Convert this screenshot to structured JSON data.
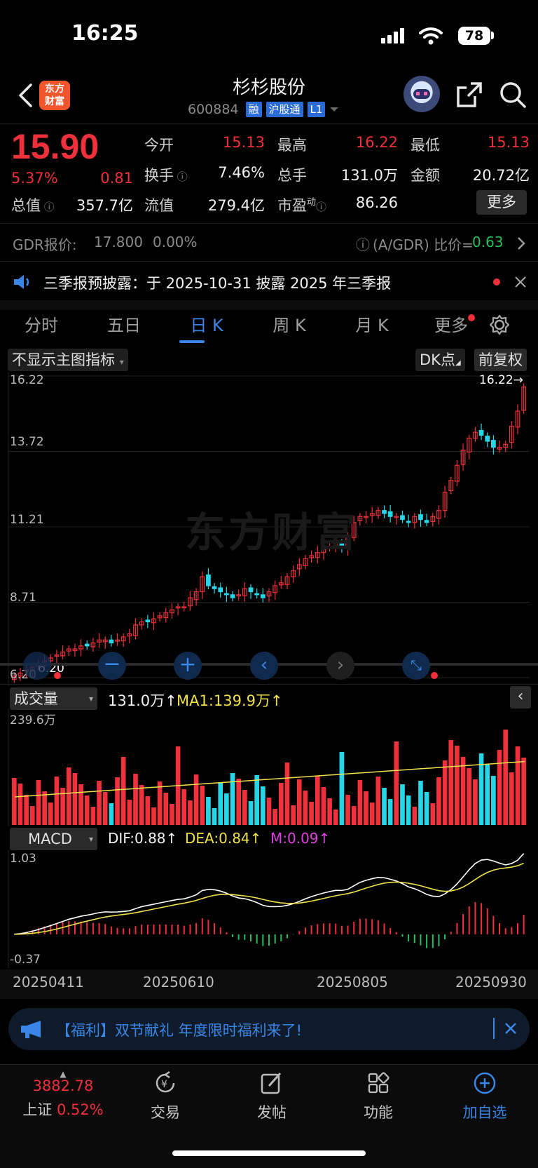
{
  "status_bar": {
    "time": "16:25",
    "battery": "78"
  },
  "header": {
    "logo_line1": "东方",
    "logo_line2": "财富",
    "stock_name": "杉杉股份",
    "stock_code": "600884",
    "tags": [
      "融",
      "沪股通",
      "L1"
    ]
  },
  "quote": {
    "price": "15.90",
    "change_pct": "5.37%",
    "change_abs": "0.81",
    "labels": {
      "open": "今开",
      "high": "最高",
      "low": "最低",
      "turnover": "换手",
      "volume": "总手",
      "amount": "金额",
      "mktcap": "总值",
      "float_cap": "流值",
      "pe": "市盈",
      "pe_sup": "动"
    },
    "values": {
      "open": "15.13",
      "high": "16.22",
      "low": "15.13",
      "turnover": "7.46%",
      "volume": "131.0万",
      "amount": "20.72亿",
      "mktcap": "357.7亿",
      "float_cap": "279.4亿",
      "pe": "86.26"
    },
    "more_button": "更多"
  },
  "gdr": {
    "label": "GDR报价:",
    "price": "17.800",
    "change": "0.00%",
    "ratio_label": "(A/GDR) 比价=",
    "ratio": "0.63"
  },
  "notice": {
    "text": "三季报预披露：于 2025-10-31 披露 2025 年三季报"
  },
  "tabs": [
    "分时",
    "五日",
    "日 K",
    "周 K",
    "月 K",
    "更多"
  ],
  "kline": {
    "indicator_select": "不显示主图指标",
    "dk_button": "DK点",
    "adjust_button": "前复权",
    "y_labels": [
      "16.22",
      "13.72",
      "11.21",
      "8.71",
      "6.20"
    ],
    "max_marker": "16.22→",
    "min_marker": "6.20",
    "watermark": "东方财富"
  },
  "volume": {
    "select": "成交量",
    "value": "131.0万",
    "ma_label": "MA1:139.9万",
    "ymax": "239.6万"
  },
  "macd": {
    "select": "MACD",
    "dif": "DIF:0.88",
    "dea": "DEA:0.84",
    "m": "M:0.09",
    "ymax": "1.03",
    "ymin": "-0.37"
  },
  "x_dates": [
    "20250411",
    "20250610",
    "20250805",
    "20250930"
  ],
  "promo": {
    "text": "【福利】双节献礼 年度限时福利来了!"
  },
  "bottom_nav": {
    "index_value": "3882.78",
    "index_name": "上证",
    "index_change": "0.52%",
    "items": [
      "交易",
      "发帖",
      "功能",
      "加自选"
    ]
  },
  "chart_data": {
    "type": "candlestick",
    "price_axis": [
      6.2,
      16.22
    ],
    "closes": [
      6.3,
      6.4,
      6.5,
      6.6,
      6.7,
      6.8,
      6.9,
      7.0,
      7.1,
      7.2,
      7.2,
      7.3,
      7.3,
      7.4,
      7.5,
      7.5,
      7.4,
      7.5,
      7.6,
      7.7,
      8.0,
      8.1,
      8.1,
      8.2,
      8.3,
      8.4,
      8.5,
      8.6,
      8.6,
      8.9,
      9.1,
      9.6,
      9.3,
      9.2,
      9.1,
      9.0,
      8.9,
      9.0,
      9.2,
      9.1,
      9.0,
      8.9,
      9.1,
      9.3,
      9.4,
      9.6,
      9.8,
      10.0,
      10.2,
      10.3,
      10.4,
      10.5,
      10.6,
      10.7,
      10.6,
      10.9,
      11.4,
      11.6,
      11.6,
      11.7,
      11.8,
      11.7,
      11.6,
      11.6,
      11.5,
      11.4,
      11.6,
      11.5,
      11.4,
      11.6,
      11.8,
      12.4,
      12.8,
      13.3,
      13.8,
      14.2,
      14.4,
      14.3,
      14.1,
      13.9,
      13.9,
      14.0,
      14.6,
      15.1,
      15.9
    ],
    "volume_axis_max": "239.6万",
    "macd_axis": [
      -0.37,
      1.03
    ]
  }
}
